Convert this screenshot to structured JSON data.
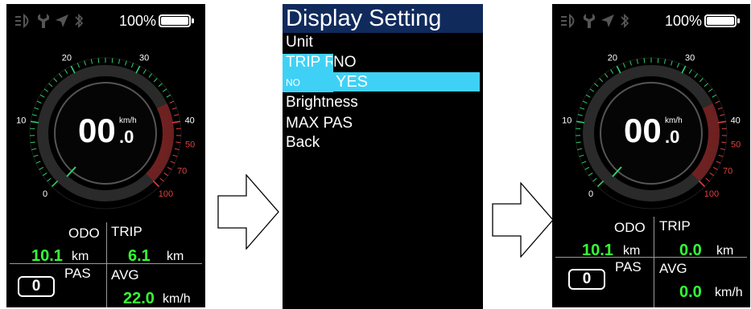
{
  "screen_left": {
    "battery_pct": "100%",
    "speed": "00",
    "speed_decimal": ".0",
    "speed_unit": "km/h",
    "gauge_ticks": [
      "0",
      "10",
      "20",
      "30",
      "40",
      "50",
      "70",
      "100"
    ],
    "odo_label": "ODO",
    "trip_label": "TRIP",
    "odo_value": "10.1",
    "odo_unit": "km",
    "trip_value": "6.1",
    "trip_unit": "km",
    "pas_label": "PAS",
    "pas_value": "0",
    "avg_label": "AVG",
    "avg_value": "22.0",
    "avg_unit": "km/h"
  },
  "menu": {
    "title": "Display Setting",
    "items": [
      "Unit",
      "TRIP R",
      "NO",
      "Brightness",
      "MAX PAS",
      "Back"
    ],
    "options": [
      "NO",
      "YES"
    ]
  },
  "screen_right": {
    "battery_pct": "100%",
    "speed": "00",
    "speed_decimal": ".0",
    "speed_unit": "km/h",
    "gauge_ticks": [
      "0",
      "10",
      "20",
      "30",
      "40",
      "50",
      "70",
      "100"
    ],
    "odo_label": "ODO",
    "trip_label": "TRIP",
    "odo_value": "10.1",
    "odo_unit": "km",
    "trip_value": "0.0",
    "trip_unit": "km",
    "pas_label": "PAS",
    "pas_value": "0",
    "avg_label": "AVG",
    "avg_value": "0.0",
    "avg_unit": "km/h"
  },
  "colors": {
    "gauge_green": "#2fd16a",
    "gauge_red": "#e04040",
    "value_green": "#35ff35",
    "menu_title_bg": "#102a5c",
    "menu_highlight": "#3fd1f5"
  },
  "icons": [
    "headlight-icon",
    "wrench-icon",
    "navigation-icon",
    "bluetooth-icon",
    "battery-icon",
    "arrow-right-icon"
  ]
}
